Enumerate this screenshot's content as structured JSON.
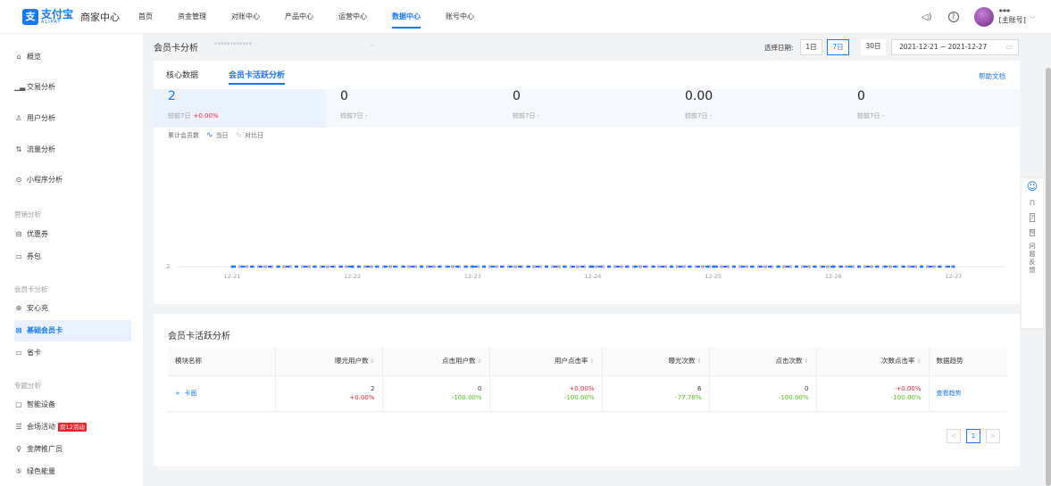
{
  "topbar": {
    "logo_mark": "支",
    "logo_cn": "支付宝",
    "logo_en": "ALIPAY",
    "brand": "商家中心",
    "nav": [
      "首页",
      "资金管理",
      "对账中心",
      "产品中心",
      "运营中心",
      "数据中心",
      "账号中心"
    ],
    "active_nav": "数据中心",
    "account_name": "***",
    "account_sub": "[主账号]"
  },
  "sidebar": {
    "items": [
      {
        "icon": "home-icon",
        "glyph": "⌂",
        "label": "概览"
      },
      {
        "icon": "trade-chart-icon",
        "glyph": "▁▃",
        "label": "交易分析"
      },
      {
        "icon": "user-analysis-icon",
        "glyph": "♙",
        "label": "用户分析"
      },
      {
        "icon": "traffic-icon",
        "glyph": "⇅",
        "label": "流量分析"
      },
      {
        "icon": "mini-program-icon",
        "glyph": "⊙",
        "label": "小程序分析"
      }
    ],
    "group_marketing": "营销分析",
    "marketing_items": [
      {
        "icon": "coupon-icon",
        "glyph": "⊟",
        "label": "优惠券"
      },
      {
        "icon": "voucher-pack-icon",
        "glyph": "▭",
        "label": "券包"
      }
    ],
    "group_member": "会员卡分析",
    "member_items": [
      {
        "icon": "safe-charge-icon",
        "glyph": "⊕",
        "label": "安心充"
      },
      {
        "icon": "basic-member-icon",
        "glyph": "⊠",
        "label": "基础会员卡"
      },
      {
        "icon": "saving-card-icon",
        "glyph": "▭",
        "label": "省卡"
      }
    ],
    "group_special": "专题分析",
    "special_items": [
      {
        "icon": "smart-device-icon",
        "glyph": "▢",
        "label": "智能设备"
      },
      {
        "icon": "venue-activity-icon",
        "glyph": "☰",
        "label": "会场活动",
        "badge": "双12活动"
      },
      {
        "icon": "promoter-icon",
        "glyph": "♀",
        "label": "金牌推广员"
      },
      {
        "icon": "green-energy-icon",
        "glyph": "⑤",
        "label": "绿色能量"
      }
    ]
  },
  "header": {
    "title": "会员卡分析",
    "store_selector": "************",
    "date_label": "选择日期:",
    "ranges": [
      "1日",
      "7日",
      "30日"
    ],
    "active_range": "7日",
    "date_range": "2021-12-21 ~ 2021-12-27"
  },
  "tabs": {
    "core": "核心数据",
    "active": "会员卡活跃分析",
    "help": "帮助文档"
  },
  "kpis": [
    {
      "value": "2",
      "cmp_label": "较前7日",
      "cmp_value": "+0.00%"
    },
    {
      "value": "0",
      "cmp_label": "较前7日",
      "cmp_value": "-"
    },
    {
      "value": "0",
      "cmp_label": "较前7日",
      "cmp_value": "-"
    },
    {
      "value": "0.00",
      "cmp_label": "较前7日",
      "cmp_value": "-"
    },
    {
      "value": "0",
      "cmp_label": "较前7日",
      "cmp_value": "-"
    }
  ],
  "legend": {
    "metric": "累计会员数",
    "current": "当日",
    "compare": "对比日"
  },
  "colors": {
    "primary": "#1677ff",
    "compare_line": "#b4a3e0",
    "up_red": "#f5222d",
    "down_green": "#52c41a"
  },
  "chart_data": {
    "type": "line",
    "x": [
      "12-21",
      "12-22",
      "12-23",
      "12-24",
      "12-25",
      "12-26",
      "12-27"
    ],
    "series": [
      {
        "name": "当日",
        "values": [
          2,
          2,
          2,
          2,
          2,
          2,
          2
        ]
      },
      {
        "name": "对比日",
        "values": [
          2,
          2,
          2,
          2,
          2,
          2,
          2
        ]
      }
    ],
    "y_ticks": [
      "2"
    ],
    "legend": "top-left"
  },
  "table": {
    "title": "会员卡活跃分析",
    "columns": [
      "模块名称",
      "曝光用户数",
      "点击用户数",
      "用户点击率",
      "曝光次数",
      "点击次数",
      "次数点击率",
      "数据趋势"
    ],
    "rows": [
      {
        "name": "卡面",
        "expand": "+",
        "cells": [
          {
            "main": "2",
            "sub": "+0.00%",
            "sub_color": "red"
          },
          {
            "main": "0",
            "sub": "-100.00%",
            "sub_color": "green"
          },
          {
            "main": "+0.00%",
            "sub": "-100.00%",
            "sub_color": "green",
            "main_color": "red"
          },
          {
            "main": "6",
            "sub": "-77.78%",
            "sub_color": "green"
          },
          {
            "main": "0",
            "sub": "-100.00%",
            "sub_color": "green"
          },
          {
            "main": "+0.00%",
            "sub": "-100.00%",
            "sub_color": "green",
            "main_color": "red"
          }
        ],
        "trend": "查看趋势"
      }
    ],
    "pager": {
      "prev": "<",
      "page": "1",
      "next": ">"
    }
  },
  "float_bar": {
    "items": [
      "问",
      "题",
      "反",
      "馈"
    ]
  }
}
